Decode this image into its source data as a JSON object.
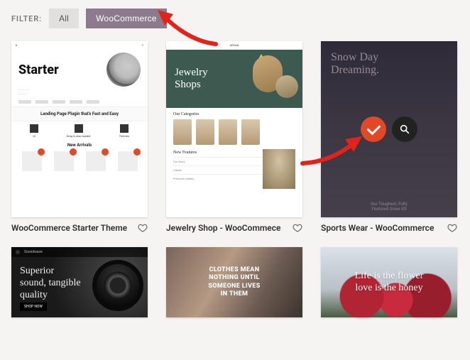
{
  "filter": {
    "label": "FILTER:",
    "all": "All",
    "woocommerce": "WooCommerce"
  },
  "themes": [
    {
      "caption": "WooCommerce Starter Theme",
      "hero_title": "Starter",
      "band_text": "Landing Page Plugin that's Fast and Easy",
      "feat1": "Drag & drop builder",
      "section": "New Arrivals"
    },
    {
      "caption": "Jewelry Shop - WooCommece",
      "brand": "ARYAN",
      "hero_line1": "Jewelry",
      "hero_line2": "Shops",
      "cat_header": "Our Categories",
      "features_header": "New Features",
      "row1": "Our Story",
      "row2": "Clients",
      "row3": "Premium Quality"
    },
    {
      "caption": "Sports Wear - WooCommerce",
      "hero_line1": "Snow Day",
      "hero_line2": "Dreaming.",
      "footer_line1": "Our Toughest, Fully",
      "footer_line2": "Featured Snow Kit",
      "icons": {
        "select": "checkmark-icon",
        "zoom": "magnify-icon"
      }
    },
    {
      "hero_line1": "Superior",
      "hero_line2": "sound, tangible",
      "hero_line3": "quality",
      "cta": "SHOP NOW"
    },
    {
      "line1": "CLOTHES MEAN",
      "line2": "NOTHING UNTIL",
      "line3": "SOMEONE LIVES",
      "line4": "IN THEM"
    },
    {
      "line1": "Life is the flower",
      "line2": "love is the honey"
    }
  ],
  "colors": {
    "accent": "#e04826",
    "filter_active": "#8c7b8e",
    "arrow": "#e2231a"
  }
}
